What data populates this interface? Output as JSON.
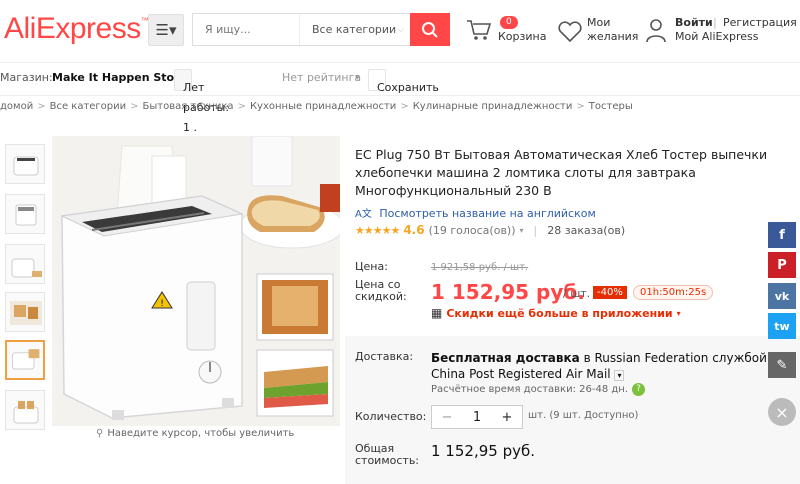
{
  "header": {
    "logo": "AliExpress",
    "search_placeholder": "Я ищу...",
    "search_category": "Все категории",
    "cart_count": "0",
    "cart_label": "Корзина",
    "wishlist_line1": "Мои",
    "wishlist_line2": "желания",
    "login": "Войти",
    "register": "Регистрация",
    "my_account": "Мой AliExpress"
  },
  "store_bar": {
    "shop_prefix": "Магазин:",
    "shop_name": "Make It Happen Store",
    "years": "Лет работы: 1 .",
    "rating": "Нет рейтинга",
    "save": "Сохранить"
  },
  "breadcrumb": [
    "домой",
    "Все категории",
    "Бытовая техника",
    "Кухонные принадлежности",
    "Кулинарные принадлежности",
    "Тостеры"
  ],
  "gallery": {
    "hint": "Наведите курсор, чтобы увеличить",
    "thumbs": 6,
    "selected_index": 4
  },
  "product": {
    "title": "EC Plug 750 Вт Бытовая Автоматическая Хлеб Тостер выпечки хлебопечки машина 2 ломтика слоты для завтрака Многофункциональный 230 В",
    "en_link": "Посмотреть название на английском",
    "rating_value": "4.6",
    "votes": "(19 голоса(ов))",
    "orders": "28 заказа(ов)",
    "price_label": "Цена:",
    "old_price": "1 921,58 руб. / шт.",
    "disc_label_1": "Цена со",
    "disc_label_2": "скидкой:",
    "new_price": "1 152,95 руб.",
    "unit": "/ шт.",
    "discount": "-40%",
    "timer": "01h:50m:25s",
    "app_discount": "Скидки ещё больше в приложении",
    "delivery_label": "Доставка:",
    "delivery_text_1": "Бесплатная доставка",
    "delivery_text_2": "в Russian Federation службой China Post Registered Air Mail",
    "delivery_time": "Расчётное время доставки: 26-48 дн.",
    "qty_label": "Количество:",
    "qty_value": "1",
    "qty_info": "шт. (9 шт. Доступно)",
    "total_label_1": "Общая",
    "total_label_2": "стоимость:",
    "total_value": "1 152,95 руб."
  },
  "colors": {
    "brand": "#ff4747",
    "facebook": "#3b5998",
    "pinterest": "#cb2027",
    "vk": "#4c75a3",
    "twitter": "#1da1f2"
  }
}
